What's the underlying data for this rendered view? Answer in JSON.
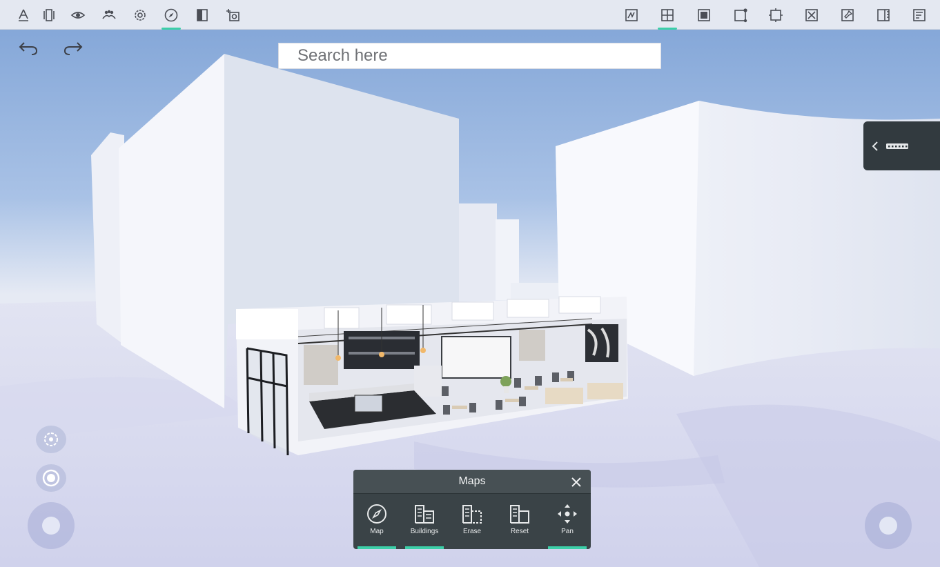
{
  "toolbar": {
    "left_tools": [
      {
        "name": "measure-icon",
        "active": false
      },
      {
        "name": "layers-icon",
        "active": false
      },
      {
        "name": "eye-icon",
        "active": false
      },
      {
        "name": "people-icon",
        "active": false
      },
      {
        "name": "settings-icon",
        "active": false
      },
      {
        "name": "compass-icon",
        "active": true
      },
      {
        "name": "split-view-icon",
        "active": false
      },
      {
        "name": "camera-icon",
        "active": false
      }
    ],
    "right_tools": [
      {
        "name": "sketch-icon",
        "active": false
      },
      {
        "name": "grid-icon",
        "active": true
      },
      {
        "name": "fill-square-icon",
        "active": false
      },
      {
        "name": "node-square-icon",
        "active": false
      },
      {
        "name": "expand-square-icon",
        "active": false
      },
      {
        "name": "cross-square-icon",
        "active": false
      },
      {
        "name": "pin-square-icon",
        "active": false
      },
      {
        "name": "ruler-icon",
        "active": false
      },
      {
        "name": "notes-icon",
        "active": false
      }
    ],
    "accent_color": "#3ccfa8"
  },
  "history": {
    "undo_icon": "undo-icon",
    "redo_icon": "redo-icon"
  },
  "search": {
    "placeholder": "Search here",
    "value": ""
  },
  "side_panel": {
    "icon": "chevron-left-icon",
    "label_icon": "dots-icon"
  },
  "left_controls": {
    "orbit_icon": "orbit-icon",
    "target_icon": "target-icon",
    "joystick": "joystick"
  },
  "maps": {
    "title": "Maps",
    "close_icon": "close-icon",
    "tools": [
      {
        "label": "Map",
        "icon": "compass-icon",
        "active": true
      },
      {
        "label": "Buildings",
        "icon": "buildings-icon",
        "active": true
      },
      {
        "label": "Erase",
        "icon": "erase-building-icon",
        "active": false
      },
      {
        "label": "Reset",
        "icon": "reset-building-icon",
        "active": false
      },
      {
        "label": "Pan",
        "icon": "pan-icon",
        "active": true
      }
    ]
  }
}
